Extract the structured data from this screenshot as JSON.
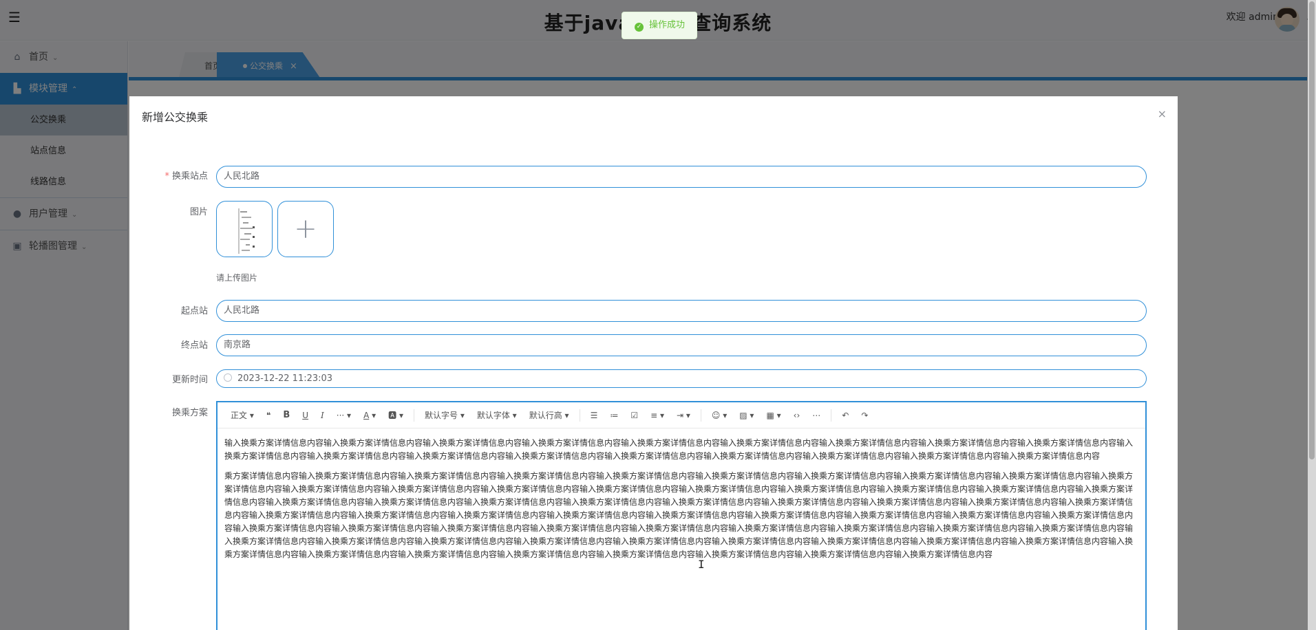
{
  "header": {
    "title": "基于java的公交查询系统",
    "welcome": "欢迎 admin"
  },
  "sidebar": {
    "items": [
      {
        "label": "首页",
        "icon": "home-icon",
        "expanded": false
      },
      {
        "label": "模块管理",
        "icon": "module-icon",
        "expanded": true,
        "children": [
          "公交换乘",
          "站点信息",
          "线路信息"
        ],
        "active_child": "公交换乘"
      },
      {
        "label": "用户管理",
        "icon": "user-icon",
        "expanded": false
      },
      {
        "label": "轮播图管理",
        "icon": "carousel-icon",
        "expanded": false
      }
    ]
  },
  "tabs": [
    {
      "label": "首页",
      "active": false
    },
    {
      "label": "公交换乘",
      "active": true,
      "closable": true
    }
  ],
  "toast": {
    "text": "操作成功",
    "type": "success"
  },
  "dialog": {
    "title": "新增公交换乘",
    "close_glyph": "×",
    "form": {
      "transfer_station": {
        "label": "换乘站点",
        "required": true,
        "value": "人民北路"
      },
      "image": {
        "label": "图片",
        "tip": "请上传图片"
      },
      "start_station": {
        "label": "起点站",
        "value": "人民北路"
      },
      "end_station": {
        "label": "终点站",
        "value": "南京路"
      },
      "update_time": {
        "label": "更新时间",
        "value": "2023-12-22 11:23:03"
      },
      "plan": {
        "label": "换乘方案"
      }
    },
    "editor": {
      "toolbar": {
        "heading": "正文",
        "font_size": "默认字号",
        "font_family": "默认字体",
        "line_height": "默认行高"
      },
      "paragraphs": [
        "输入换乘方案详情信息内容输入换乘方案详情信息内容输入换乘方案详情信息内容输入换乘方案详情信息内容输入换乘方案详情信息内容输入换乘方案详情信息内容输入换乘方案详情信息内容输入换乘方案详情信息内容输入换乘方案详情信息内容输入换乘方案详情信息内容输入换乘方案详情信息内容输入换乘方案详情信息内容输入换乘方案详情信息内容输入换乘方案详情信息内容输入换乘方案详情信息内容输入换乘方案详情信息内容输入换乘方案详情信息内容输入换乘方案详情信息内容",
        "乘方案详情信息内容输入换乘方案详情信息内容输入换乘方案详情信息内容输入换乘方案详情信息内容输入换乘方案详情信息内容输入换乘方案详情信息内容输入换乘方案详情信息内容输入换乘方案详情信息内容输入换乘方案详情信息内容输入换乘方案详情信息内容输入换乘方案详情信息内容输入换乘方案详情信息内容输入换乘方案详情信息内容输入换乘方案详情信息内容输入换乘方案详情信息内容输入换乘方案详情信息内容输入换乘方案详情信息内容输入换乘方案详情信息内容输入换乘方案详情信息内容输入换乘方案详情信息内容输入换乘方案详情信息内容输入换乘方案详情信息内容输入换乘方案详情信息内容输入换乘方案详情信息内容输入换乘方案详情信息内容输入换乘方案详情信息内容输入换乘方案详情信息内容输入换乘方案详情信息内容输入换乘方案详情信息内容输入换乘方案详情信息内容输入换乘方案详情信息内容输入换乘方案详情信息内容输入换乘方案详情信息内容输入换乘方案详情信息内容输入换乘方案详情信息内容输入换乘方案详情信息内容输入换乘方案详情信息内容输入换乘方案详情信息内容输入换乘方案详情信息内容输入换乘方案详情信息内容输入换乘方案详情信息内容输入换乘方案详情信息内容输入换乘方案详情信息内容输入换乘方案详情信息内容输入换乘方案详情信息内容输入换乘方案详情信息内容输入换乘方案详情信息内容输入换乘方案详情信息内容输入换乘方案详情信息内容输入换乘方案详情信息内容输入换乘方案详情信息内容输入换乘方案详情信息内容输入换乘方案详情信息内容输入换乘方案详情信息内容输入换乘方案详情信息内容输入换乘方案详情信息内容输入换乘方案详情信息内容输入换乘方案详情信息内容输入换乘方案详情信息内容输入换乘方案详情信息内容输入换乘方案详情信息内容输入换乘方案详情信息内容输入换乘方案详情信息内容"
      ]
    }
  },
  "colors": {
    "accent": "#2f8fd8",
    "success": "#67c23a",
    "overlay": "rgba(0,0,0,0.5)"
  }
}
